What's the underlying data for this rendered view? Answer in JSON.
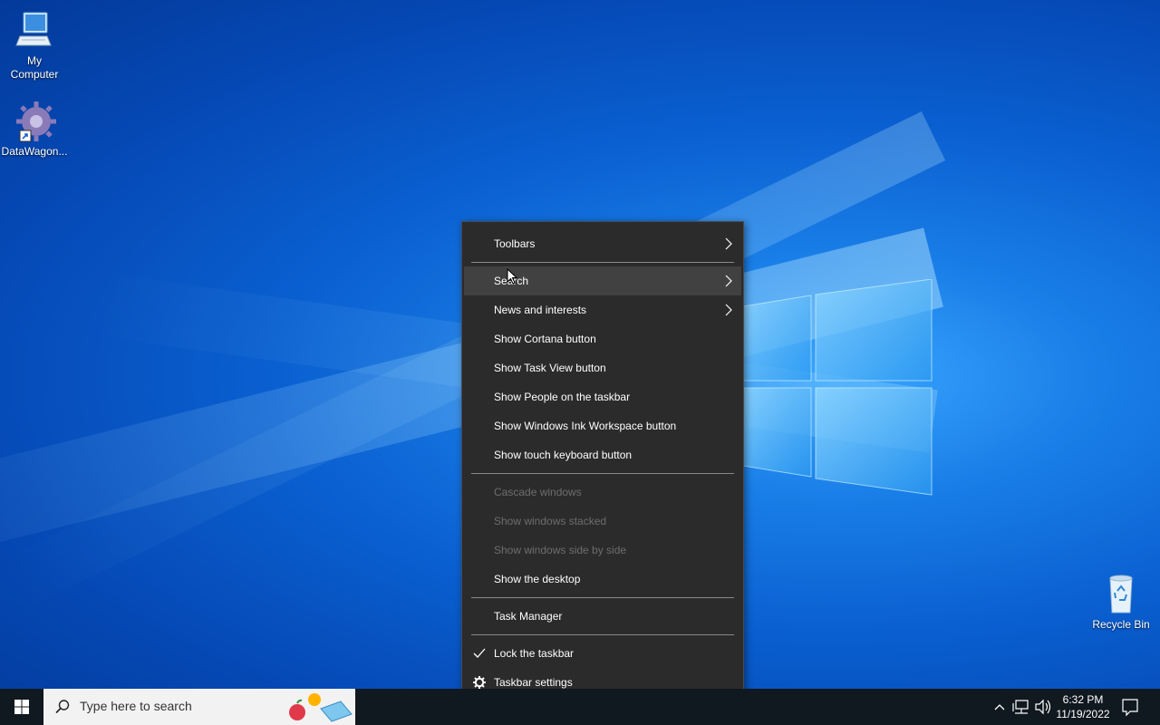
{
  "desktop": {
    "icons": [
      {
        "label": "My\nComputer",
        "label_line1": "My",
        "label_line2": "Computer",
        "icon": "computer-icon"
      },
      {
        "label": "DataWagon...",
        "icon": "gear-shortcut-icon"
      },
      {
        "label": "Recycle Bin",
        "icon": "recycle-bin-icon"
      }
    ]
  },
  "context_menu": {
    "items": [
      {
        "label": "Toolbars",
        "submenu": true
      },
      {
        "label": "Search",
        "submenu": true,
        "highlighted": true
      },
      {
        "label": "News and interests",
        "submenu": true
      },
      {
        "label": "Show Cortana button"
      },
      {
        "label": "Show Task View button"
      },
      {
        "label": "Show People on the taskbar"
      },
      {
        "label": "Show Windows Ink Workspace button"
      },
      {
        "label": "Show touch keyboard button"
      },
      {
        "label": "Cascade windows",
        "disabled": true
      },
      {
        "label": "Show windows stacked",
        "disabled": true
      },
      {
        "label": "Show windows side by side",
        "disabled": true
      },
      {
        "label": "Show the desktop"
      },
      {
        "label": "Task Manager"
      },
      {
        "label": "Lock the taskbar",
        "checked": true
      },
      {
        "label": "Taskbar settings",
        "icon": "gear-icon"
      }
    ]
  },
  "taskbar": {
    "search_placeholder": "Type here to search",
    "clock_time": "6:32 PM",
    "clock_date": "11/19/2022"
  },
  "colors": {
    "menu_bg": "#2b2b2b",
    "menu_hover": "#414141",
    "taskbar_bg": "#101820",
    "desktop_blue": "#0a5fd0"
  }
}
